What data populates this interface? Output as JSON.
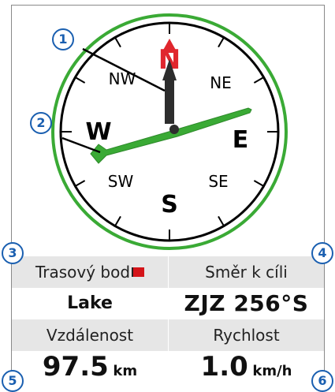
{
  "compass": {
    "cardinals": [
      "N",
      "E",
      "S",
      "W"
    ],
    "intercardinals": [
      "NE",
      "SE",
      "SW",
      "NW"
    ],
    "colors": {
      "ring_outer": "#3aaa35",
      "ring_inner": "#000000",
      "north": "#e0262d",
      "needle": "#2d2d2d",
      "course_pointer": "#3aaa35"
    }
  },
  "fields": {
    "label_top_left": "Trasový bod",
    "value_top_left": "Lake",
    "label_top_right": "Směr k cíli",
    "value_top_right": "ZJZ 256°S",
    "label_bottom_left": "Vzdálenost",
    "value_bottom_left": "97.5",
    "unit_bottom_left": "km",
    "label_bottom_right": "Rychlost",
    "value_bottom_right": "1.0",
    "unit_bottom_right": "km/h"
  },
  "callouts": [
    "1",
    "2",
    "3",
    "4",
    "5",
    "6"
  ],
  "icons": {
    "waypoint": "red-flag-icon"
  }
}
